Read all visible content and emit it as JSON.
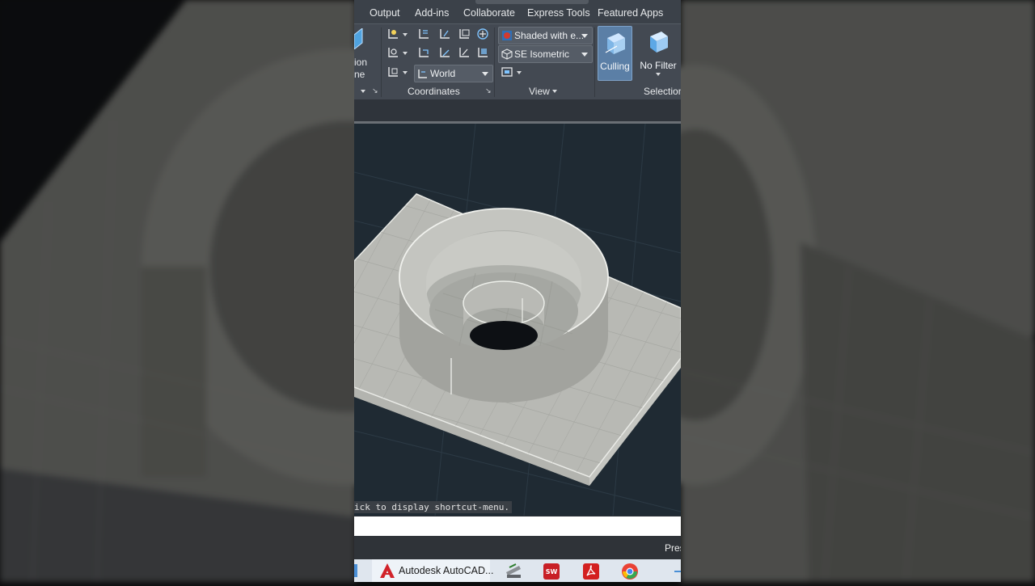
{
  "app": {
    "name": "Autodesk AutoCAD"
  },
  "ribbon": {
    "tabs": [
      "Output",
      "Add-ins",
      "Collaborate",
      "Express Tools",
      "Featured Apps"
    ],
    "left_cut_labels": [
      "ion",
      "ne"
    ],
    "coordinates_label": "Coordinates",
    "view_label": "View",
    "selection_label": "Selection",
    "ucs_combo": "World",
    "visual_style_combo": "Shaded with e...",
    "view_combo": "SE Isometric",
    "culling_label": "Culling",
    "no_filter_label": "No Filter"
  },
  "command": {
    "history_text": "ick to display shortcut-menu.",
    "input_value": ""
  },
  "status": {
    "right_text": "Pres"
  },
  "taskbar": {
    "autocad_label": "Autodesk AutoCAD..."
  },
  "icons": [
    "ucs-icon",
    "culling-cube-icon",
    "no-filter-cube-icon",
    "autocad-icon",
    "solidworks-icon",
    "acrobat-icon",
    "chrome-icon"
  ],
  "colors": {
    "accent": "#5b7fa6",
    "viewport": "#1f2a33",
    "model_face": "#a9aba6",
    "autocad_red": "#d1232a"
  }
}
